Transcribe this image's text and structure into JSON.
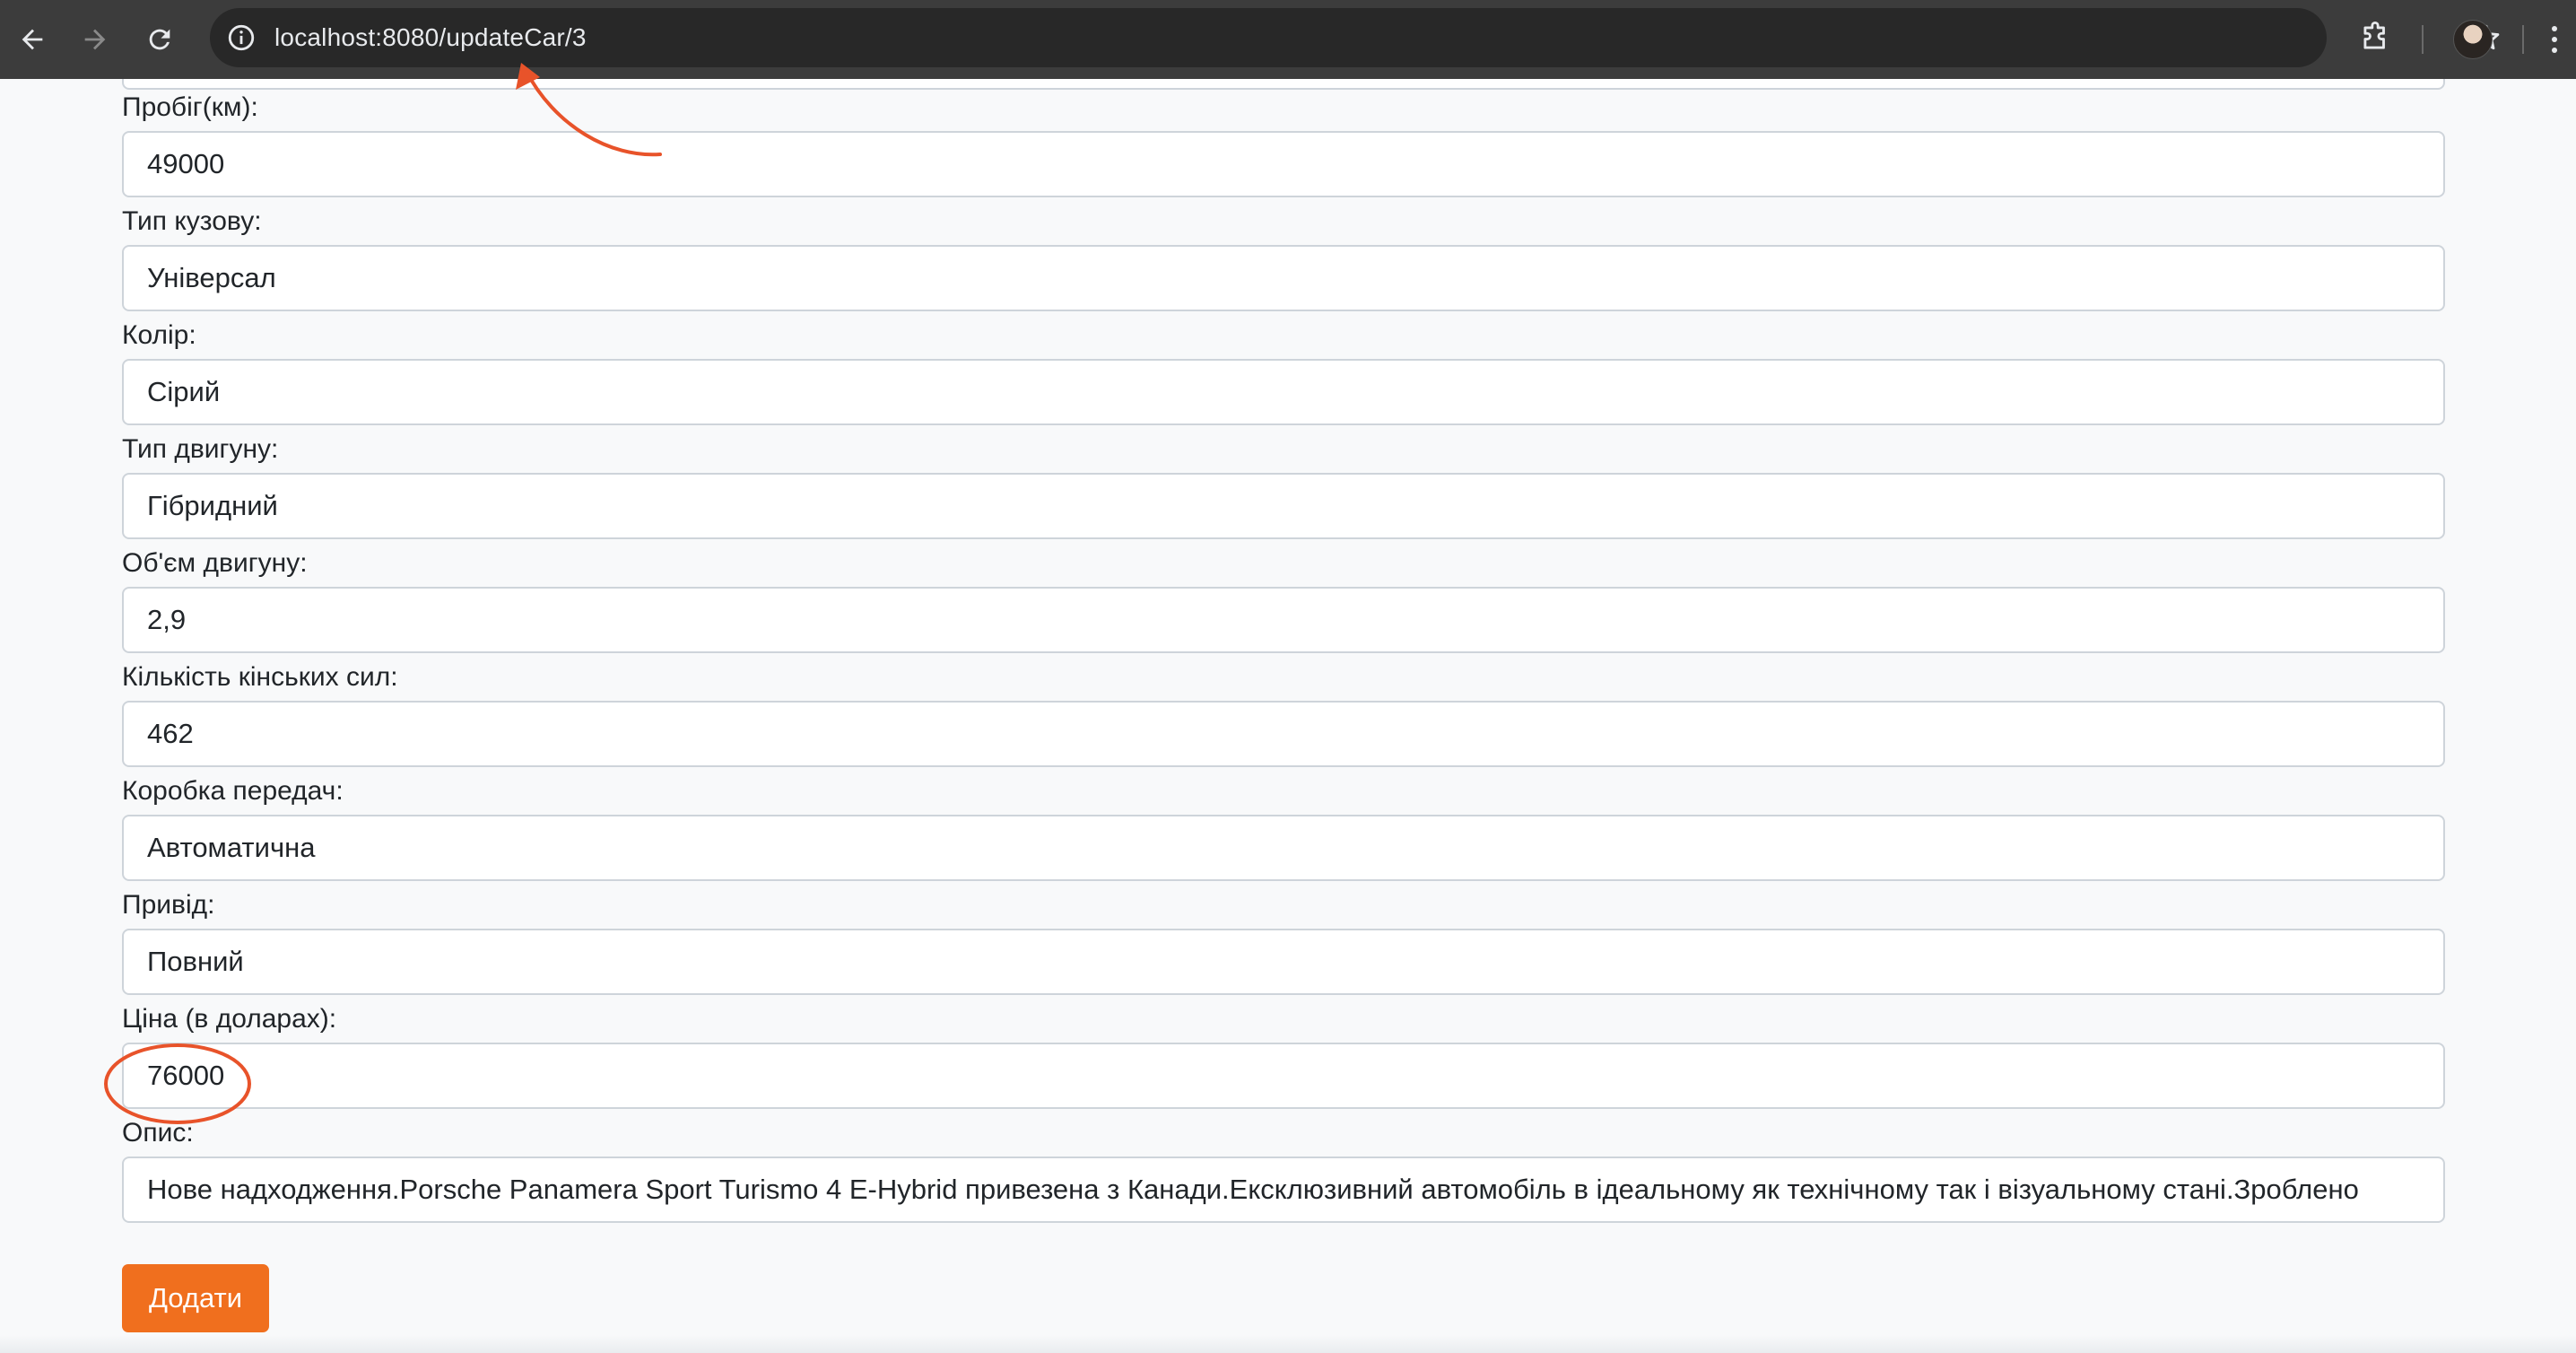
{
  "browser": {
    "url": "localhost:8080/updateCar/3"
  },
  "form": {
    "fields": [
      {
        "label": "Пробіг(км):",
        "value": "49000"
      },
      {
        "label": "Тип кузову:",
        "value": "Універсал"
      },
      {
        "label": "Колір:",
        "value": "Сірий"
      },
      {
        "label": "Тип двигуну:",
        "value": "Гібридний"
      },
      {
        "label": "Об'єм двигуну:",
        "value": "2,9"
      },
      {
        "label": "Кількість кінських сил:",
        "value": "462"
      },
      {
        "label": "Коробка передач:",
        "value": "Автоматична"
      },
      {
        "label": "Привід:",
        "value": "Повний"
      },
      {
        "label": "Ціна (в доларах):",
        "value": "76000"
      },
      {
        "label": "Опис:",
        "value": "Нове надходження.Porsche Panamera Sport Turismo 4 E-Hybrid привезена з Канади.Ексклюзивний автомобіль в ідеальному як технічному так і візуальному стані.Зроблено"
      }
    ],
    "submit_label": "Додати"
  },
  "annotation_color": "#e8532a"
}
